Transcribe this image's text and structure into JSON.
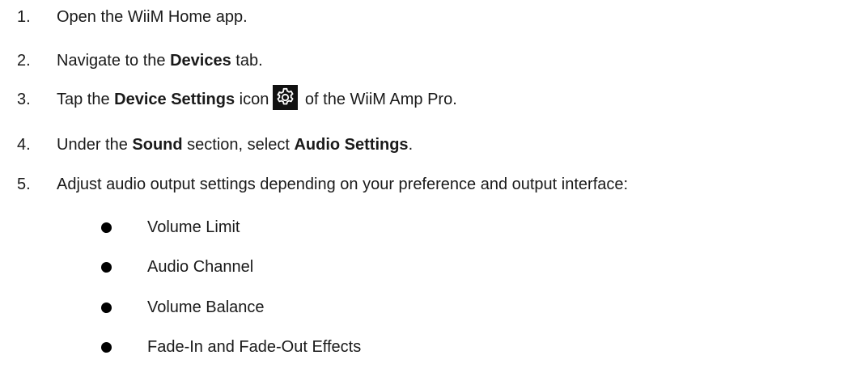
{
  "steps": [
    {
      "number": "1.",
      "parts": [
        "Open the WiiM Home app."
      ]
    },
    {
      "number": "2.",
      "pre": "Navigate to the ",
      "bold": "Devices",
      "post": " tab."
    },
    {
      "number": "3.",
      "pre": "Tap the ",
      "bold": "Device Settings",
      "mid": " icon",
      "icon": "gear-icon",
      "post": " of the WiiM Amp Pro."
    },
    {
      "number": "4.",
      "pre": "Under the ",
      "bold1": "Sound",
      "mid": " section, select ",
      "bold2": "Audio Settings",
      "post": "."
    },
    {
      "number": "5.",
      "text": "Adjust audio output settings depending on your preference and output interface:"
    }
  ],
  "bullets": [
    "Volume Limit",
    "Audio Channel",
    "Volume Balance",
    "Fade-In and Fade-Out Effects"
  ]
}
